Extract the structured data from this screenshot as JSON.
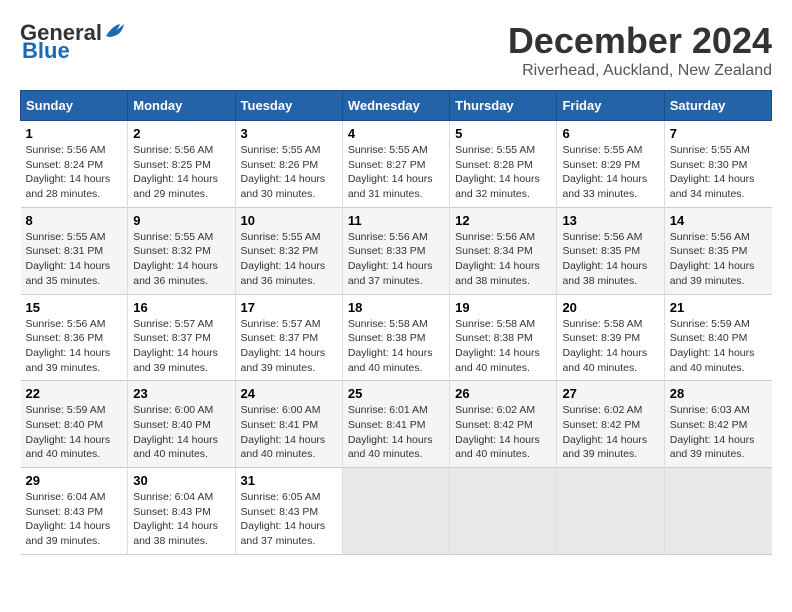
{
  "header": {
    "logo_general": "General",
    "logo_blue": "Blue",
    "month_title": "December 2024",
    "location": "Riverhead, Auckland, New Zealand"
  },
  "days_of_week": [
    "Sunday",
    "Monday",
    "Tuesday",
    "Wednesday",
    "Thursday",
    "Friday",
    "Saturday"
  ],
  "weeks": [
    [
      {
        "day": "1",
        "sunrise": "5:56 AM",
        "sunset": "8:24 PM",
        "daylight": "14 hours and 28 minutes."
      },
      {
        "day": "2",
        "sunrise": "5:56 AM",
        "sunset": "8:25 PM",
        "daylight": "14 hours and 29 minutes."
      },
      {
        "day": "3",
        "sunrise": "5:55 AM",
        "sunset": "8:26 PM",
        "daylight": "14 hours and 30 minutes."
      },
      {
        "day": "4",
        "sunrise": "5:55 AM",
        "sunset": "8:27 PM",
        "daylight": "14 hours and 31 minutes."
      },
      {
        "day": "5",
        "sunrise": "5:55 AM",
        "sunset": "8:28 PM",
        "daylight": "14 hours and 32 minutes."
      },
      {
        "day": "6",
        "sunrise": "5:55 AM",
        "sunset": "8:29 PM",
        "daylight": "14 hours and 33 minutes."
      },
      {
        "day": "7",
        "sunrise": "5:55 AM",
        "sunset": "8:30 PM",
        "daylight": "14 hours and 34 minutes."
      }
    ],
    [
      {
        "day": "8",
        "sunrise": "5:55 AM",
        "sunset": "8:31 PM",
        "daylight": "14 hours and 35 minutes."
      },
      {
        "day": "9",
        "sunrise": "5:55 AM",
        "sunset": "8:32 PM",
        "daylight": "14 hours and 36 minutes."
      },
      {
        "day": "10",
        "sunrise": "5:55 AM",
        "sunset": "8:32 PM",
        "daylight": "14 hours and 36 minutes."
      },
      {
        "day": "11",
        "sunrise": "5:56 AM",
        "sunset": "8:33 PM",
        "daylight": "14 hours and 37 minutes."
      },
      {
        "day": "12",
        "sunrise": "5:56 AM",
        "sunset": "8:34 PM",
        "daylight": "14 hours and 38 minutes."
      },
      {
        "day": "13",
        "sunrise": "5:56 AM",
        "sunset": "8:35 PM",
        "daylight": "14 hours and 38 minutes."
      },
      {
        "day": "14",
        "sunrise": "5:56 AM",
        "sunset": "8:35 PM",
        "daylight": "14 hours and 39 minutes."
      }
    ],
    [
      {
        "day": "15",
        "sunrise": "5:56 AM",
        "sunset": "8:36 PM",
        "daylight": "14 hours and 39 minutes."
      },
      {
        "day": "16",
        "sunrise": "5:57 AM",
        "sunset": "8:37 PM",
        "daylight": "14 hours and 39 minutes."
      },
      {
        "day": "17",
        "sunrise": "5:57 AM",
        "sunset": "8:37 PM",
        "daylight": "14 hours and 39 minutes."
      },
      {
        "day": "18",
        "sunrise": "5:58 AM",
        "sunset": "8:38 PM",
        "daylight": "14 hours and 40 minutes."
      },
      {
        "day": "19",
        "sunrise": "5:58 AM",
        "sunset": "8:38 PM",
        "daylight": "14 hours and 40 minutes."
      },
      {
        "day": "20",
        "sunrise": "5:58 AM",
        "sunset": "8:39 PM",
        "daylight": "14 hours and 40 minutes."
      },
      {
        "day": "21",
        "sunrise": "5:59 AM",
        "sunset": "8:40 PM",
        "daylight": "14 hours and 40 minutes."
      }
    ],
    [
      {
        "day": "22",
        "sunrise": "5:59 AM",
        "sunset": "8:40 PM",
        "daylight": "14 hours and 40 minutes."
      },
      {
        "day": "23",
        "sunrise": "6:00 AM",
        "sunset": "8:40 PM",
        "daylight": "14 hours and 40 minutes."
      },
      {
        "day": "24",
        "sunrise": "6:00 AM",
        "sunset": "8:41 PM",
        "daylight": "14 hours and 40 minutes."
      },
      {
        "day": "25",
        "sunrise": "6:01 AM",
        "sunset": "8:41 PM",
        "daylight": "14 hours and 40 minutes."
      },
      {
        "day": "26",
        "sunrise": "6:02 AM",
        "sunset": "8:42 PM",
        "daylight": "14 hours and 40 minutes."
      },
      {
        "day": "27",
        "sunrise": "6:02 AM",
        "sunset": "8:42 PM",
        "daylight": "14 hours and 39 minutes."
      },
      {
        "day": "28",
        "sunrise": "6:03 AM",
        "sunset": "8:42 PM",
        "daylight": "14 hours and 39 minutes."
      }
    ],
    [
      {
        "day": "29",
        "sunrise": "6:04 AM",
        "sunset": "8:43 PM",
        "daylight": "14 hours and 39 minutes."
      },
      {
        "day": "30",
        "sunrise": "6:04 AM",
        "sunset": "8:43 PM",
        "daylight": "14 hours and 38 minutes."
      },
      {
        "day": "31",
        "sunrise": "6:05 AM",
        "sunset": "8:43 PM",
        "daylight": "14 hours and 37 minutes."
      },
      null,
      null,
      null,
      null
    ]
  ]
}
